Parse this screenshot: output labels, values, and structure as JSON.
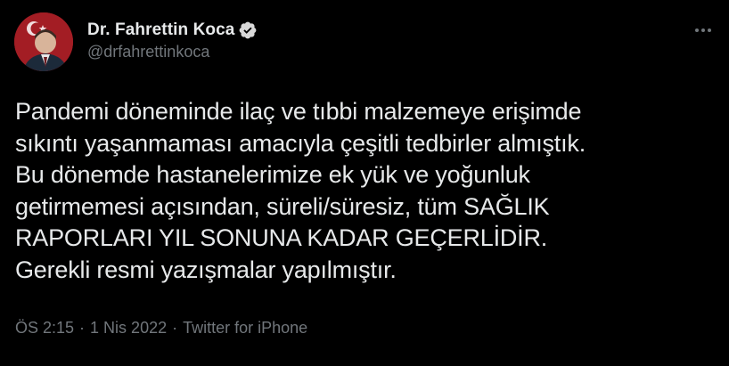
{
  "author": {
    "display_name": "Dr. Fahrettin Koca",
    "handle": "@drfahrettinkoca",
    "verified_icon": "verified-badge-icon",
    "avatar_icon": "avatar-with-flag"
  },
  "menu": {
    "more_icon": "more-options-icon"
  },
  "tweet": {
    "lines": [
      "Pandemi döneminde ilaç ve tıbbi malzemeye erişimde",
      "sıkıntı yaşanmaması amacıyla çeşitli tedbirler almıştık.",
      "Bu dönemde hastanelerimize ek yük ve yoğunluk",
      "getirmemesi açısından, süreli/süresiz, tüm SAĞLIK",
      "RAPORLARI YIL SONUNA KADAR GEÇERLİDİR.",
      "Gerekli resmi yazışmalar yapılmıştır."
    ]
  },
  "meta": {
    "time": "ÖS 2:15",
    "separator": "·",
    "date": "1 Nis 2022",
    "source": "Twitter for iPhone"
  },
  "colors": {
    "background": "#000000",
    "text": "#e7e9ea",
    "muted": "#71767b",
    "verified": "#d9d9d9"
  }
}
